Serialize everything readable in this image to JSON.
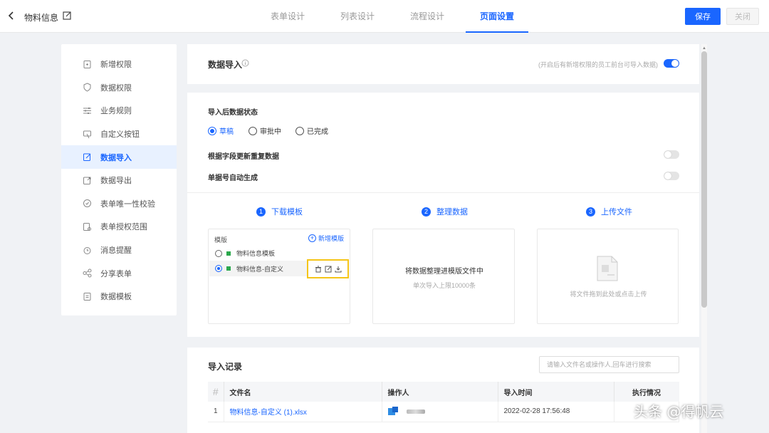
{
  "header": {
    "title": "物料信息",
    "tabs": [
      {
        "label": "表单设计"
      },
      {
        "label": "列表设计"
      },
      {
        "label": "流程设计"
      },
      {
        "label": "页面设置"
      }
    ],
    "active_tab": "页面设置",
    "save_label": "保存",
    "close_label": "关闭"
  },
  "sidebar": {
    "items": [
      {
        "label": "新增权限",
        "icon": "add-permission-icon"
      },
      {
        "label": "数据权限",
        "icon": "shield-icon"
      },
      {
        "label": "业务规则",
        "icon": "sliders-icon"
      },
      {
        "label": "自定义按钮",
        "icon": "custom-button-icon"
      },
      {
        "label": "数据导入",
        "icon": "import-icon"
      },
      {
        "label": "数据导出",
        "icon": "export-icon"
      },
      {
        "label": "表单唯一性校验",
        "icon": "unique-check-icon"
      },
      {
        "label": "表单授权范围",
        "icon": "authorize-icon"
      },
      {
        "label": "消息提醒",
        "icon": "clock-icon"
      },
      {
        "label": "分享表单",
        "icon": "share-icon"
      },
      {
        "label": "数据模板",
        "icon": "template-icon"
      }
    ],
    "active": "数据导入"
  },
  "import_section": {
    "title": "数据导入",
    "hint": "(开启后有新增权限的员工前台可导入数据)",
    "enabled": true
  },
  "settings": {
    "status_label": "导入后数据状态",
    "status_options": [
      "草稿",
      "审批中",
      "已完成"
    ],
    "status_selected": "草稿",
    "dedupe_label": "根据字段更新重复数据",
    "dedupe_enabled": false,
    "auto_number_label": "单据号自动生成",
    "auto_number_enabled": false
  },
  "steps": [
    {
      "num": "1",
      "label": "下载模板"
    },
    {
      "num": "2",
      "label": "整理数据"
    },
    {
      "num": "3",
      "label": "上传文件"
    }
  ],
  "templates": {
    "header": "模版",
    "add_label": "新增模版",
    "items": [
      {
        "name": "物料信息模板",
        "selected": false
      },
      {
        "name": "物料信息-自定义",
        "selected": true
      }
    ]
  },
  "organize": {
    "text": "将数据整理进模版文件中",
    "limit": "单次导入上限10000条"
  },
  "upload": {
    "text": "将文件拖到此处或点击上传"
  },
  "records": {
    "title": "导入记录",
    "search_placeholder": "请输入文件名或操作人,回车进行搜索",
    "columns": [
      "#",
      "文件名",
      "操作人",
      "导入时间",
      "执行情况"
    ],
    "rows": [
      {
        "index": "1",
        "file": "物料信息-自定义 (1).xlsx",
        "operator": "",
        "time": "2022-02-28 17:56:48",
        "status": ""
      }
    ]
  },
  "watermark": "头条 @得帆云",
  "colors": {
    "accent": "#1a66ff",
    "highlight": "#f5c518"
  }
}
